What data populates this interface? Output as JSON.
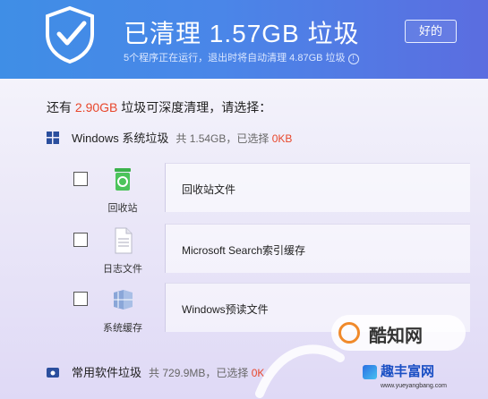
{
  "header": {
    "headline": "已清理 1.57GB 垃圾",
    "subline": "5个程序正在运行，退出时将自动清理 4.87GB 垃圾",
    "ok_button": "好的",
    "info_glyph": "!"
  },
  "prompt": {
    "before": "还有 ",
    "amount": "2.90GB",
    "after": " 垃圾可深度清理，请选择："
  },
  "sections": {
    "windows": {
      "title": "Windows 系统垃圾",
      "meta": "共 1.54GB，已选择 ",
      "selected": "0KB",
      "icon": "windows-logo-icon"
    },
    "software": {
      "title": "常用软件垃圾",
      "meta": "共 729.9MB，已选择 ",
      "selected": "0K",
      "icon": "software-icon"
    }
  },
  "items": [
    {
      "icon_label": "回收站",
      "name": "回收站文件",
      "icon": "recycle-bin-icon"
    },
    {
      "icon_label": "日志文件",
      "name": "Microsoft Search索引缓存",
      "icon": "log-file-icon"
    },
    {
      "icon_label": "系统缓存",
      "name": "Windows预读文件",
      "icon": "system-cache-icon"
    }
  ],
  "watermark": {
    "brand": "酷知网",
    "site_title": "趣丰富网",
    "site_url": "www.yueyangbang.com"
  },
  "colors": {
    "accent_red": "#e8472c",
    "header_blue": "#4a86e8"
  }
}
